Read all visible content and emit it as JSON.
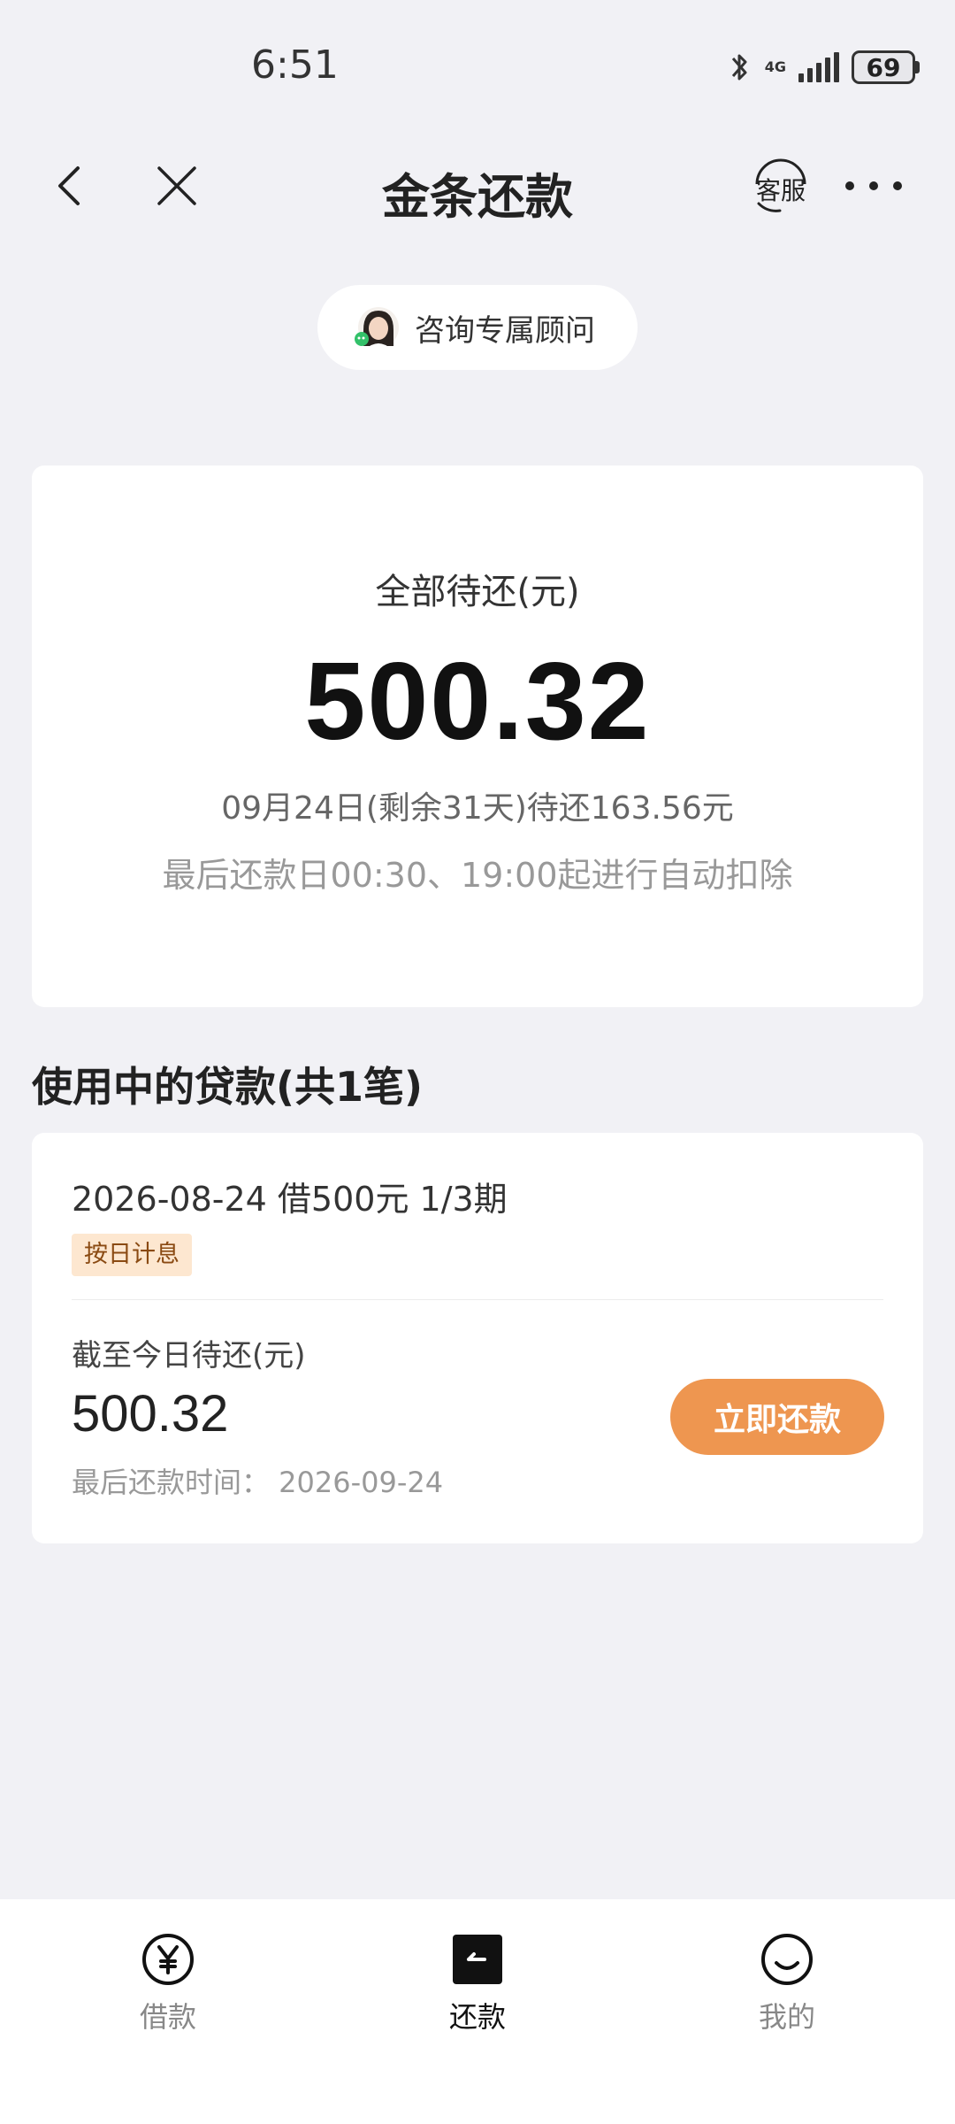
{
  "status_bar": {
    "time": "6:51",
    "network": "4G",
    "battery": "69"
  },
  "nav": {
    "title": "金条还款",
    "service_label": "客服"
  },
  "consult": {
    "label": "咨询专属顾问"
  },
  "summary": {
    "label": "全部待还(元)",
    "amount": "500.32",
    "due_info": "09月24日(剩余31天)待还163.56元",
    "auto_deduct_note": "最后还款日00:30、19:00起进行自动扣除"
  },
  "loans_section": {
    "title": "使用中的贷款(共1笔)",
    "items": [
      {
        "heading": "2026-08-24 借500元 1/3期",
        "tag": "按日计息",
        "due_label": "截至今日待还(元)",
        "due_amount": "500.32",
        "last_date": "最后还款时间：  2026-09-24",
        "button_label": "立即还款"
      }
    ]
  },
  "tabs": [
    {
      "label": "借款",
      "icon": "yen-circle-icon",
      "active": false
    },
    {
      "label": "还款",
      "icon": "repay-icon",
      "active": true
    },
    {
      "label": "我的",
      "icon": "smile-icon",
      "active": false
    }
  ],
  "colors": {
    "accent": "#ee9650",
    "tag_bg": "#fde7d0",
    "tag_text": "#8a4a12",
    "background": "#f1f1f5"
  }
}
